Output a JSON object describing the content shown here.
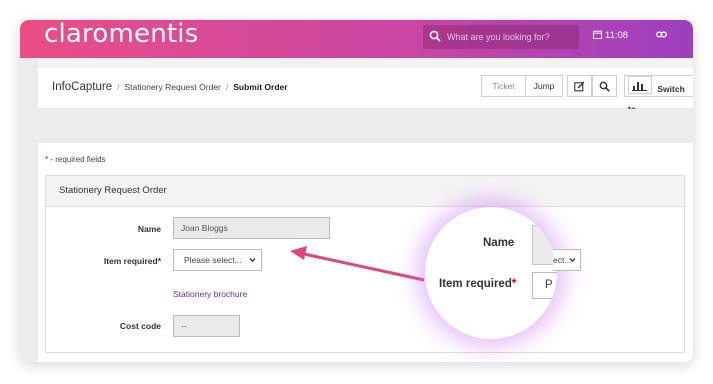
{
  "header": {
    "brand": "claromentis",
    "search_placeholder": "What are you looking for?",
    "time": "11:08",
    "icons": [
      "search-icon",
      "calendar-icon",
      "link-icon"
    ],
    "gradient": [
      "#ea4e86",
      "#c946a4",
      "#9b3fc0"
    ]
  },
  "breadcrumb": {
    "items": [
      "InfoCapture",
      "Stationery Request Order"
    ],
    "current": "Submit Order"
  },
  "toolbar": {
    "ticket_label": "Ticket",
    "jump_label": "Jump",
    "edit_icon": "edit-icon",
    "search_icon": "search-icon",
    "chart_icon": "bar-chart-icon",
    "switch_label": "Switch to"
  },
  "form": {
    "required_note": " - required fields",
    "required_star": "*",
    "title": "Stationery Request Order",
    "name_label": "Name",
    "name_value": "Joan Bloggs",
    "item_label": "Item required",
    "item_placeholder": "Please select...",
    "brochure_link": "Stationery brochure",
    "cost_label": "Cost code",
    "cost_value": "--"
  },
  "magnifier": {
    "name_label": "Name",
    "item_label": "Item required",
    "select_fragment": "ect...",
    "input_fragment": "P"
  },
  "colors": {
    "accent_arrow": "#e0457f",
    "required": "#cc0000",
    "link": "#6a2aa0"
  }
}
